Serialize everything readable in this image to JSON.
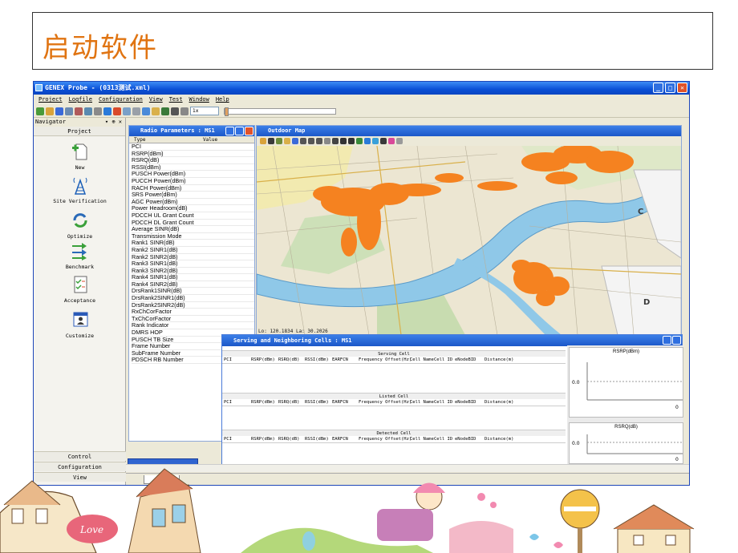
{
  "slide": {
    "title": "启动软件"
  },
  "window": {
    "title": "GENEX Probe - (0313测试.xml)",
    "menu": [
      "Project",
      "Logfile",
      "Configuration",
      "View",
      "Test",
      "Window",
      "Help"
    ],
    "zoom": "1x"
  },
  "navigator": {
    "header": "Navigator",
    "header_controls": "▾ ⊕ ✕",
    "section_top": "Project",
    "items": [
      {
        "label": "New",
        "icon": "new-file-icon"
      },
      {
        "label": "Site Verification",
        "icon": "antenna-tower-icon"
      },
      {
        "label": "Optimize",
        "icon": "optimize-arrows-icon"
      },
      {
        "label": "Benchmark",
        "icon": "benchmark-arrows-icon"
      },
      {
        "label": "Acceptance",
        "icon": "checklist-icon"
      },
      {
        "label": "Customize",
        "icon": "customize-user-icon"
      }
    ],
    "bottom_sections": [
      "Control",
      "Configuration",
      "View"
    ]
  },
  "radio_params": {
    "title": "Radio Parameters : MS1",
    "col_type": "Type",
    "col_value": "Value",
    "rows": [
      "PCI",
      "RSRP(dBm)",
      "RSRQ(dB)",
      "RSSI(dBm)",
      "PUSCH Power(dBm)",
      "PUCCH Power(dBm)",
      "RACH Power(dBm)",
      "SRS Power(dBm)",
      "AGC Power(dBm)",
      "Power Headroom(dB)",
      "PDCCH UL Grant Count",
      "PDCCH DL Grant Count",
      "Average SINR(dB)",
      "Transmission Mode",
      "Rank1 SINR(dB)",
      "Rank2 SINR1(dB)",
      "Rank2 SINR2(dB)",
      "Rank3 SINR1(dB)",
      "Rank3 SINR2(dB)",
      "Rank4 SINR1(dB)",
      "Rank4 SINR2(dB)",
      "DrsRank1SINR(dB)",
      "DrsRank2SINR1(dB)",
      "DrsRank2SINR2(dB)",
      "RxChCorFactor",
      "TxChCorFactor",
      "Rank Indicator",
      "DMRS HOP",
      "PUSCH TB Size",
      "Frame Number",
      "SubFrame Number",
      "PDSCH RB Number"
    ]
  },
  "map": {
    "title": "Outdoor Map",
    "coords": "Lo: 120.1834  La: 30.2026",
    "labels": [
      "C",
      "D"
    ]
  },
  "cells": {
    "title": "Serving and Neighboring Cells : MS1",
    "sections": [
      "Serving Cell",
      "Listed Cell",
      "Detected Cell"
    ],
    "columns": [
      "PCI",
      "RSRP(dBm)",
      "RSRQ(dB)",
      "RSSI(dBm)",
      "EARFCN",
      "Frequency Offset(Hz)",
      "Cell Name",
      "Cell ID",
      "eNodeBID",
      "Distance(m)"
    ],
    "charts": [
      {
        "title": "RSRP(dBm)",
        "y_value": "0.0",
        "x_value": "0"
      },
      {
        "title": "RSRQ(dB)",
        "y_value": "0.0",
        "x_value": "0"
      }
    ]
  },
  "statusbar": {
    "page_tab": "page 1"
  },
  "colors": {
    "title_orange": "#e07412",
    "xp_blue": "#0a4fd6",
    "river": "#8fc8e8",
    "coverage_orange": "#f58220"
  }
}
